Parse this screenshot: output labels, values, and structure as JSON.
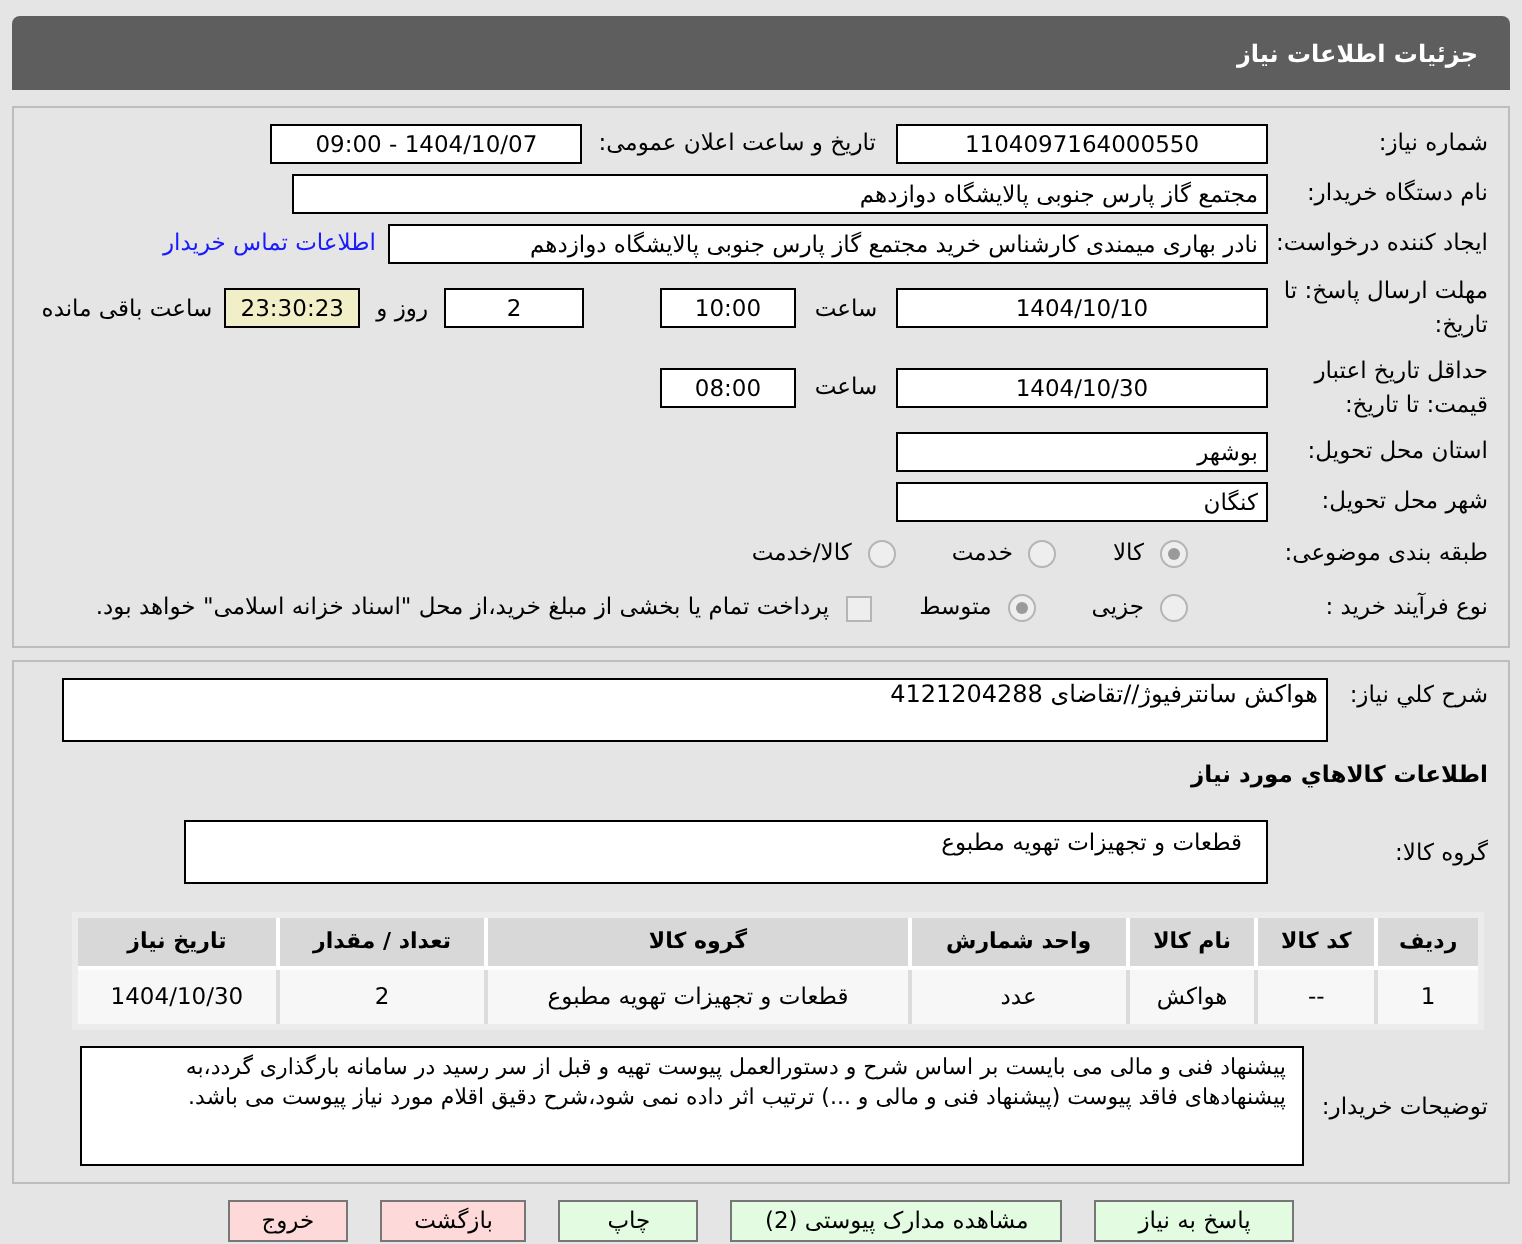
{
  "header": {
    "title": "جزئیات اطلاعات نیاز"
  },
  "need_number": {
    "label": "شماره نیاز:",
    "value": "1104097164000550"
  },
  "announce": {
    "label": "تاریخ و ساعت اعلان عمومی:",
    "value": "1404/10/07 - 09:00"
  },
  "buyer": {
    "label": "نام دستگاه خریدار:",
    "value": "مجتمع گاز پارس جنوبی  پالایشگاه دوازدهم"
  },
  "creator": {
    "label": "ایجاد کننده درخواست:",
    "value": "نادر بهاری میمندی کارشناس خرید مجتمع گاز پارس جنوبی  پالایشگاه دوازدهم",
    "link": "اطلاعات تماس خریدار"
  },
  "deadline": {
    "label": "مهلت ارسال پاسخ: تا تاریخ:",
    "date": "1404/10/10",
    "time_label": "ساعت",
    "time": "10:00",
    "days": "2",
    "days_label": "روز و",
    "remaining": "23:30:23",
    "remaining_label": "ساعت باقی مانده"
  },
  "validity": {
    "label": "حداقل تاریخ اعتبار قیمت: تا تاریخ:",
    "date": "1404/10/30",
    "time_label": "ساعت",
    "time": "08:00"
  },
  "province": {
    "label": "استان محل تحویل:",
    "value": "بوشهر"
  },
  "city": {
    "label": "شهر محل تحویل:",
    "value": "کنگان"
  },
  "category": {
    "label": "طبقه بندی موضوعی:",
    "options": [
      {
        "label": "کالا",
        "selected": true
      },
      {
        "label": "خدمت",
        "selected": false
      },
      {
        "label": "کالا/خدمت",
        "selected": false
      }
    ]
  },
  "process": {
    "label": "نوع فرآیند خرید :",
    "options": [
      {
        "label": "جزیی",
        "selected": false
      },
      {
        "label": "متوسط",
        "selected": true
      }
    ],
    "payment": {
      "checked": false,
      "label": "پرداخت تمام یا بخشی از مبلغ خرید،از محل \"اسناد خزانه اسلامی\" خواهد بود."
    }
  },
  "summary": {
    "label": "شرح کلي نياز:",
    "value": "هواکش سانترفیوژ//تقاضای 4121204288"
  },
  "goods_title": "اطلاعات کالاهاي مورد نياز",
  "goods_group": {
    "label": "گروه کالا:",
    "value": "قطعات و تجهیزات تهویه مطبوع"
  },
  "table": {
    "columns": [
      "ردیف",
      "کد کالا",
      "نام کالا",
      "واحد شمارش",
      "گروه کالا",
      "تعداد / مقدار",
      "تاریخ نیاز"
    ],
    "rows": [
      [
        "1",
        "--",
        "هواکش",
        "عدد",
        "قطعات و تجهیزات تهویه مطبوع",
        "2",
        "1404/10/30"
      ]
    ]
  },
  "notes": {
    "label": "توضیحات خریدار:",
    "value": "پیشنهاد فنی و مالی می بایست بر اساس شرح و دستورالعمل پیوست تهیه و قبل از سر رسید در سامانه بارگذاری گردد،به پیشنهادهای فاقد پیوست (پیشنهاد فنی و مالی و ...) ترتیب اثر داده نمی شود،شرح دقیق اقلام مورد نیاز پیوست می باشد."
  },
  "buttons": [
    {
      "label": "پاسخ به نیاز",
      "kind": "primary"
    },
    {
      "label": "مشاهده مدارک پیوستی (2)",
      "kind": "primary"
    },
    {
      "label": "چاپ",
      "kind": "primary"
    },
    {
      "label": "بازگشت",
      "kind": "danger"
    },
    {
      "label": "خروج",
      "kind": "danger"
    }
  ]
}
